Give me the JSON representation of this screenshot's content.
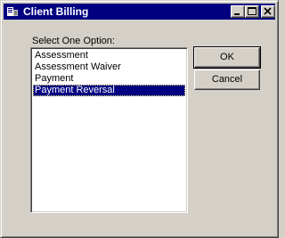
{
  "window": {
    "title": "Client Billing",
    "icon": "billing-app-icon",
    "controls": {
      "minimize_icon": "minimize-icon",
      "maximize_icon": "maximize-icon",
      "close_icon": "close-icon"
    }
  },
  "dialog": {
    "prompt": "Select One Option:",
    "options": [
      "Assessment",
      "Assessment Waiver",
      "Payment",
      "Payment Reversal"
    ],
    "selected_option": "Payment Reversal",
    "ok_label": "OK",
    "cancel_label": "Cancel"
  },
  "colors": {
    "titlebar": "#000080",
    "face": "#d4d0c8",
    "selection": "#000080"
  }
}
